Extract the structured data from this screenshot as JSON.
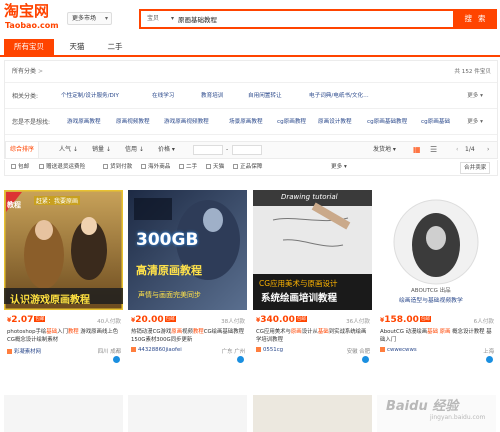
{
  "header": {
    "logo_cn": "淘宝网",
    "logo_en": "Taobao.com",
    "market_label": "更多市场",
    "search_category": "宝贝",
    "search_query": "原画基础教程",
    "search_button": "搜 索"
  },
  "tabs": [
    "所有宝贝",
    "天猫",
    "二手"
  ],
  "filters": {
    "row1": {
      "label": "所有分类",
      "arrow": ">",
      "count": "共 152 件宝贝"
    },
    "row2": {
      "label": "相关分类:",
      "options": [
        "个性定制/设计服务/DIY",
        "在线学习",
        "教育培训",
        "自用闲置转让",
        "电子词典/电纸书/文化…"
      ],
      "more": "更多"
    },
    "row3": {
      "label": "您是不是想找:",
      "options": [
        "游戏原画教程",
        "原画视频教程",
        "游戏原画视频教程",
        "场景原画教程",
        "cg原画教程",
        "原画设计教程",
        "cg原画基础教程",
        "cg原画基础"
      ],
      "more": "更多"
    }
  },
  "sort": {
    "items": [
      "综合排序",
      "人气",
      "销量",
      "信用",
      "价格"
    ],
    "price_sep": "-",
    "ship_from": "发货地",
    "page": "1/4"
  },
  "checks": {
    "items": [
      "包邮",
      "赠送退货运费险",
      "货到付款",
      "海外商品",
      "二手",
      "天猫",
      "正品保障"
    ],
    "more": "更多",
    "seller": "合并卖家"
  },
  "products": [
    {
      "price": "2.07",
      "currency": "¥",
      "badge": "包邮",
      "paid": "40人付款",
      "title_pre": "photoshop手绘",
      "title_hl1": "基础",
      "title_mid": "入门",
      "title_hl2": "教程",
      "title_post": " 游戏原画线上色CG概念设计绘制素材",
      "shop": "彩凝素材网",
      "loc": "四川 成都",
      "img_title": "认识游戏原画教程",
      "img_top": "赶紧：我要原画",
      "img_side": "教程"
    },
    {
      "price": "20.00",
      "currency": "¥",
      "badge": "包邮",
      "paid": "38人付款",
      "title_pre": "热销动漫CG游戏",
      "title_hl1": "原画",
      "title_mid": "视频",
      "title_hl2": "教程",
      "title_post": "CG绘画基础教程 150G素材300G同步更新",
      "shop": "44328860jiaofei",
      "loc": "广东 广州",
      "img_title": "300GB",
      "img_sub": "高清原画教程",
      "img_sub2": "声情与画面完美同步"
    },
    {
      "price": "340.00",
      "currency": "¥",
      "badge": "包邮",
      "paid": "36人付款",
      "title_pre": "CG应用美术与",
      "title_hl1": "原画",
      "title_mid": "设计从",
      "title_hl2": "基础",
      "title_post": "到实战系统绘画学培训教程",
      "shop": "0551cg",
      "loc": "安徽 合肥",
      "img_title": "Drawing tutorial",
      "img_sub": "CG应用美术与原画设计",
      "img_sub2": "系统绘画培训教程"
    },
    {
      "price": "158.00",
      "currency": "¥",
      "badge": "包邮",
      "paid": "6人付款",
      "title_pre": "AboutCG 动漫绘画",
      "title_hl1": "基础",
      "title_mid": " ",
      "title_hl2": "原画",
      "title_post": " 概念设计教程 基础入门",
      "shop": "cwwecwws",
      "loc": "上海",
      "img_title": "ABOUTCG 出品",
      "img_sub": "绘画造型与基础视频教学"
    }
  ],
  "watermark": "Baidu 经验",
  "watermark_sub": "jingyan.baidu.com",
  "colors": {
    "accent": "#ff4400",
    "link": "#2c4a8c"
  }
}
